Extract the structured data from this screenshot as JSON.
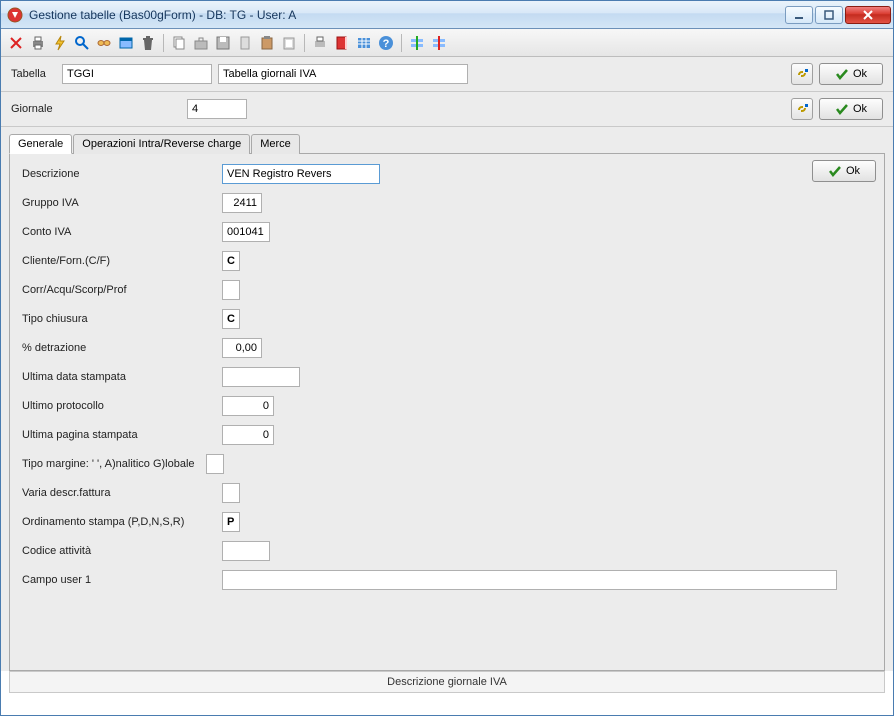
{
  "window": {
    "title": "Gestione tabelle  (Bas00gForm) - DB: TG - User: A"
  },
  "header": {
    "tabella_label": "Tabella",
    "tabella_code": "TGGI",
    "tabella_desc": "Tabella giornali IVA",
    "giornale_label": "Giornale",
    "giornale_value": "4",
    "ok_label": "Ok"
  },
  "tabs": {
    "t1": "Generale",
    "t2": "Operazioni Intra/Reverse charge",
    "t3": "Merce"
  },
  "form": {
    "descrizione_label": "Descrizione",
    "descrizione_value": "VEN Registro Revers",
    "gruppo_iva_label": "Gruppo IVA",
    "gruppo_iva_value": "2411",
    "conto_iva_label": "Conto IVA",
    "conto_iva_value": "001041",
    "cliente_forn_label": "Cliente/Forn.(C/F)",
    "cliente_forn_value": "C",
    "corr_label": "Corr/Acqu/Scorp/Prof",
    "corr_value": "",
    "tipo_chiusura_label": "Tipo chiusura",
    "tipo_chiusura_value": "C",
    "detrazione_label": "% detrazione",
    "detrazione_value": "0,00",
    "ultima_data_label": "Ultima data stampata",
    "ultima_data_value": "",
    "ultimo_protocollo_label": "Ultimo protocollo",
    "ultimo_protocollo_value": "0",
    "ultima_pagina_label": "Ultima pagina stampata",
    "ultima_pagina_value": "0",
    "tipo_margine_label": "Tipo margine: ' ', A)nalitico G)lobale",
    "tipo_margine_value": "",
    "varia_descr_label": "Varia descr.fattura",
    "varia_descr_value": "",
    "ordinamento_label": "Ordinamento stampa (P,D,N,S,R)",
    "ordinamento_value": "P",
    "codice_attivita_label": "Codice attività",
    "codice_attivita_value": "",
    "campo_user_label": "Campo user 1",
    "campo_user_value": ""
  },
  "status": {
    "text": "Descrizione giornale IVA"
  }
}
